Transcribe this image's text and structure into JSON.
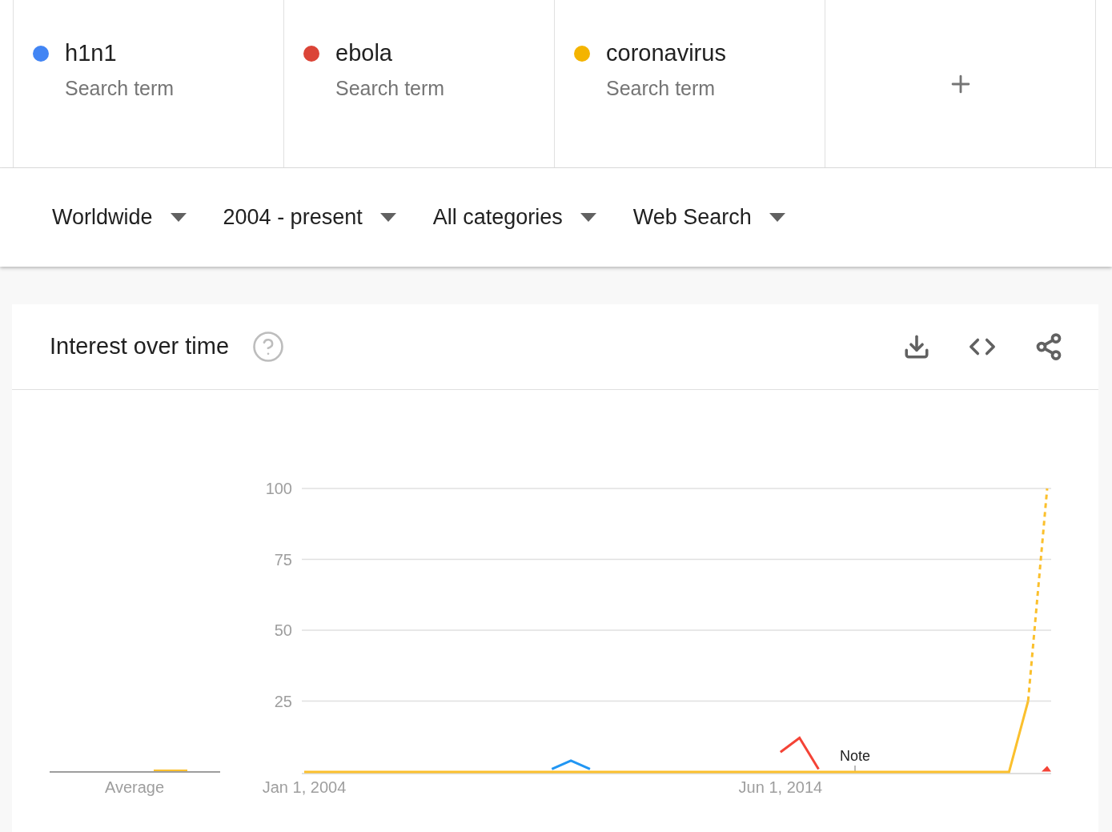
{
  "terms": [
    {
      "name": "h1n1",
      "subtitle": "Search term",
      "color": "#4285f4"
    },
    {
      "name": "ebola",
      "subtitle": "Search term",
      "color": "#db4437"
    },
    {
      "name": "coronavirus",
      "subtitle": "Search term",
      "color": "#f4b400"
    }
  ],
  "filters": [
    "Worldwide",
    "2004 - present",
    "All categories",
    "Web Search"
  ],
  "panel": {
    "title": "Interest over time",
    "average_label": "Average",
    "chart_data": {
      "type": "line",
      "categories": [
        "Jan 1, 2004",
        null,
        null,
        null,
        null,
        null,
        null,
        null,
        null,
        null,
        null,
        null,
        null,
        null,
        null,
        null,
        null,
        null,
        null,
        null,
        null,
        null,
        null,
        null,
        null,
        "Jun 1, 2014",
        null,
        null,
        null,
        null,
        null,
        null,
        null,
        null,
        null,
        null,
        null,
        null,
        null,
        null
      ],
      "ylim": [
        0,
        100
      ],
      "grid": true,
      "yticks": [
        25,
        50,
        75,
        100
      ],
      "series": [
        {
          "color": "#2196f3",
          "values": [
            null,
            null,
            null,
            null,
            null,
            null,
            null,
            null,
            null,
            null,
            null,
            null,
            null,
            1,
            4,
            1,
            null,
            null,
            null,
            null,
            null,
            null,
            null,
            null,
            null,
            null,
            null,
            null,
            null,
            null,
            null,
            null,
            null,
            null,
            null,
            null,
            null,
            null,
            null,
            null
          ]
        },
        {
          "color": "#f44336",
          "values": [
            null,
            null,
            null,
            null,
            null,
            null,
            null,
            null,
            null,
            null,
            null,
            null,
            null,
            null,
            null,
            null,
            null,
            null,
            null,
            null,
            null,
            null,
            null,
            null,
            null,
            7,
            12,
            1,
            null,
            null,
            null,
            null,
            null,
            null,
            null,
            null,
            null,
            null,
            null,
            1
          ]
        },
        {
          "color": "#fbc02d",
          "values": [
            0,
            0,
            0,
            0,
            0,
            0,
            0,
            0,
            0,
            0,
            0,
            0,
            0,
            0,
            0,
            0,
            0,
            0,
            0,
            0,
            0,
            0,
            0,
            0,
            0,
            0,
            0,
            0,
            0,
            0,
            0,
            0,
            0,
            0,
            0,
            0,
            0,
            0,
            25,
            100
          ]
        }
      ],
      "annotations": [
        "Note"
      ]
    }
  }
}
